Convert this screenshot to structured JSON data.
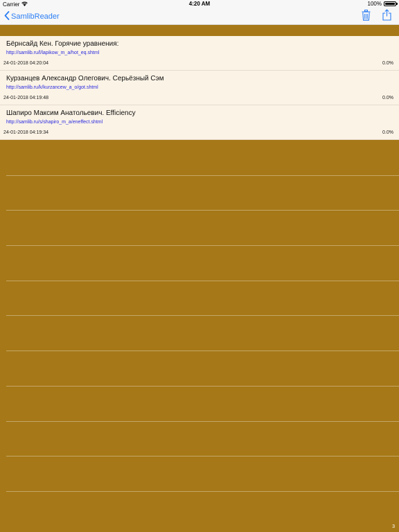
{
  "status_bar": {
    "carrier": "Carrier",
    "time": "4:20 AM",
    "battery": "100%"
  },
  "nav": {
    "back_label": "SamlibReader",
    "icons": [
      "trash-icon",
      "share-icon"
    ],
    "accent_color": "#2b7ef5"
  },
  "items": [
    {
      "title": "Бёрнсайд Кен. Горячие уравнения:",
      "url": "http://samlib.ru/l/lapikow_m_a/hot_eq.shtml",
      "date": "24-01-2018 04:20:04",
      "progress": "0.0%"
    },
    {
      "title": "Курзанцев Александр Олегович. Серьёзный Сэм",
      "url": "http://samlib.ru/k/kurzancew_a_o/got.shtml",
      "date": "24-01-2018 04:19:48",
      "progress": "0.0%"
    },
    {
      "title": "Шапиро Максим Анатольевич. Efficiency",
      "url": "http://samlib.ru/s/shapiro_m_a/eneffect.shtml",
      "date": "24-01-2018 04:19:34",
      "progress": "0.0%"
    }
  ],
  "footer": {
    "count": "3"
  },
  "colors": {
    "background": "#a67817",
    "row_background": "#fbf3e6",
    "link": "#2a2ae0"
  }
}
